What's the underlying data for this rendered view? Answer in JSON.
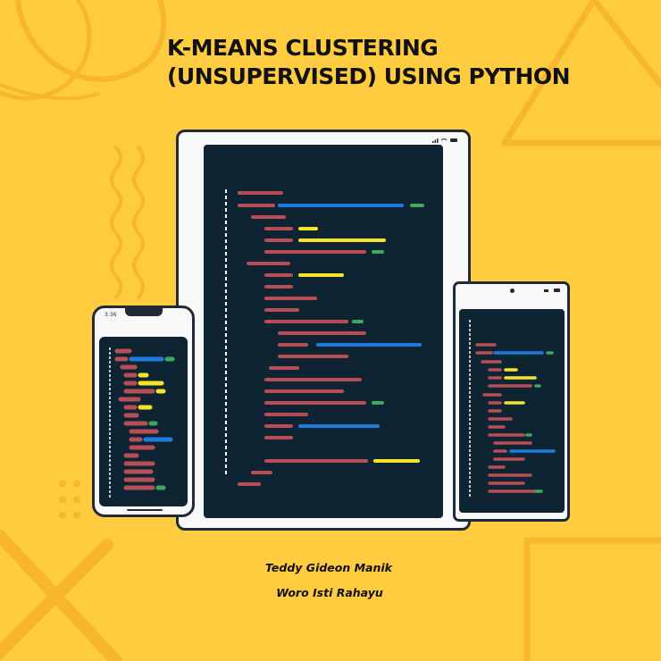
{
  "cover": {
    "title_line1": "K-MEANS CLUSTERING",
    "title_line2": "(UNSUPERVISED) USING PYTHON",
    "author1": "Teddy Gideon Manik",
    "author2": "Woro Isti Rahayu",
    "phone_clock": "3:36",
    "colors": {
      "background": "#FECC3E",
      "decoration": "#F7B62E",
      "screen": "#0F2433",
      "code_red": "#B84E55",
      "code_blue": "#1F7AE0",
      "code_yellow": "#F5E42A",
      "code_green": "#3FA85C",
      "device_outline": "#1F2B38"
    },
    "icons": [
      "wifi-icon",
      "signal-icon",
      "battery-icon",
      "camera-notch-icon"
    ]
  }
}
